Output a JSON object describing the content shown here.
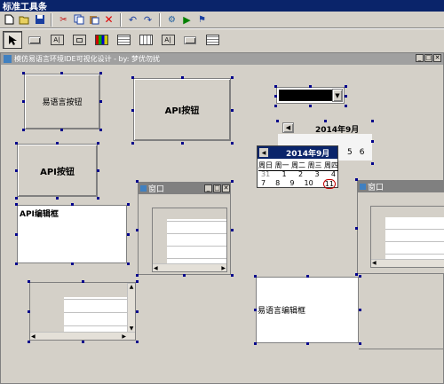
{
  "toolbar_window": {
    "title": "标准工具条"
  },
  "toolbar": {
    "items": [
      "new-file-icon",
      "open-folder-icon",
      "save-icon",
      "cut-icon",
      "copy-icon",
      "paste-icon",
      "delete-icon",
      "undo-icon",
      "redo-icon",
      "settings-icon",
      "run-icon",
      "debug-icon"
    ]
  },
  "tools": {
    "items": [
      "pointer-icon",
      "button-tool-icon",
      "label-tool-icon",
      "edit-tool-icon",
      "image-tool-icon",
      "list-tool-icon",
      "grid-tool-icon",
      "label-tool-2-icon",
      "frame-tool-icon",
      "table-tool-icon"
    ]
  },
  "designer": {
    "title": "模仿易语言环境IDE可视化设计 - by: 梦优勿扰"
  },
  "widgets": {
    "button1": "易语言按钮",
    "button2": "API按钮",
    "button3": "API按钮",
    "edit1": "API编辑框",
    "edit2": "易语言编辑框",
    "window_title": "窗口",
    "window_title2": "窗口"
  },
  "calendar": {
    "month_label": "2014年9月",
    "popup_month": "2014年9月",
    "weekdays": [
      "周日",
      "周一",
      "周二",
      "周三",
      "周四"
    ],
    "row0": [
      "31",
      "1",
      "2",
      "3",
      "4"
    ],
    "row1": [
      "7",
      "8",
      "9",
      "10",
      "11"
    ],
    "small_row": [
      "5",
      "6"
    ]
  }
}
